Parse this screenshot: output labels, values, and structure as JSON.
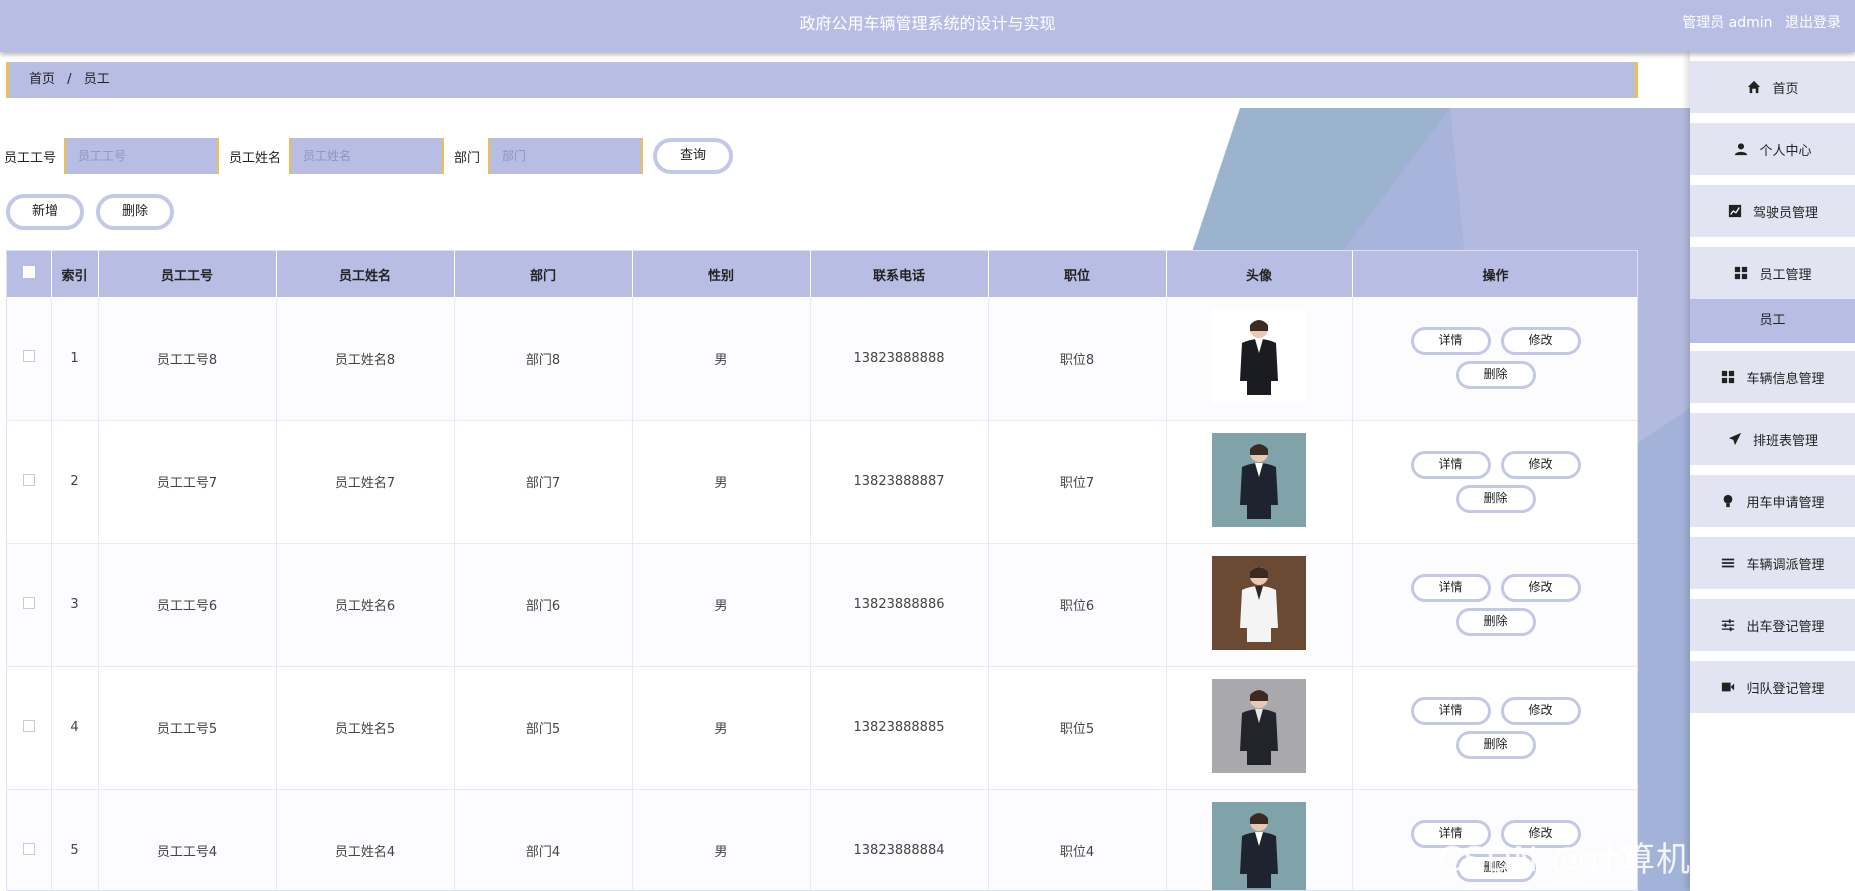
{
  "app": {
    "title": "政府公用车辆管理系统的设计与实现",
    "role_user": "管理员 admin",
    "logout": "退出登录"
  },
  "breadcrumb": {
    "home": "首页",
    "separator": "/",
    "current": "员工"
  },
  "search": {
    "emp_no_label": "员工工号",
    "emp_no_placeholder": "员工工号",
    "emp_name_label": "员工姓名",
    "emp_name_placeholder": "员工姓名",
    "dept_label": "部门",
    "dept_placeholder": "部门",
    "query_button": "查询"
  },
  "actions": {
    "add": "新增",
    "delete": "删除"
  },
  "table": {
    "headers": [
      "索引",
      "员工工号",
      "员工姓名",
      "部门",
      "性别",
      "联系电话",
      "职位",
      "头像",
      "操作"
    ],
    "row_actions": {
      "detail": "详情",
      "edit": "修改",
      "delete": "删除"
    },
    "rows": [
      {
        "index": "1",
        "emp_no": "员工工号8",
        "name": "员工姓名8",
        "dept": "部门8",
        "gender": "男",
        "phone": "13823888888",
        "position": "职位8"
      },
      {
        "index": "2",
        "emp_no": "员工工号7",
        "name": "员工姓名7",
        "dept": "部门7",
        "gender": "男",
        "phone": "13823888887",
        "position": "职位7"
      },
      {
        "index": "3",
        "emp_no": "员工工号6",
        "name": "员工姓名6",
        "dept": "部门6",
        "gender": "男",
        "phone": "13823888886",
        "position": "职位6"
      },
      {
        "index": "4",
        "emp_no": "员工工号5",
        "name": "员工姓名5",
        "dept": "部门5",
        "gender": "男",
        "phone": "13823888885",
        "position": "职位5"
      },
      {
        "index": "5",
        "emp_no": "员工工号4",
        "name": "员工姓名4",
        "dept": "部门4",
        "gender": "男",
        "phone": "13823888884",
        "position": "职位4"
      }
    ]
  },
  "sidebar": {
    "items": [
      {
        "label": "首页",
        "icon": "home-icon"
      },
      {
        "label": "个人中心",
        "icon": "user-icon"
      },
      {
        "label": "驾驶员管理",
        "icon": "chart-icon"
      },
      {
        "label": "员工管理",
        "icon": "grid-icon"
      },
      {
        "label": "车辆信息管理",
        "icon": "grid-icon"
      },
      {
        "label": "排班表管理",
        "icon": "send-icon"
      },
      {
        "label": "用车申请管理",
        "icon": "bulb-icon"
      },
      {
        "label": "车辆调派管理",
        "icon": "list-icon"
      },
      {
        "label": "出车登记管理",
        "icon": "sliders-icon"
      },
      {
        "label": "归队登记管理",
        "icon": "film-icon"
      }
    ],
    "sub_item": "员工"
  },
  "watermark": "CSDN @计算机程序_设计",
  "colors": {
    "theme": "#b8bde3",
    "accent": "#f1c04a",
    "button_border": "#c3c7e8"
  }
}
